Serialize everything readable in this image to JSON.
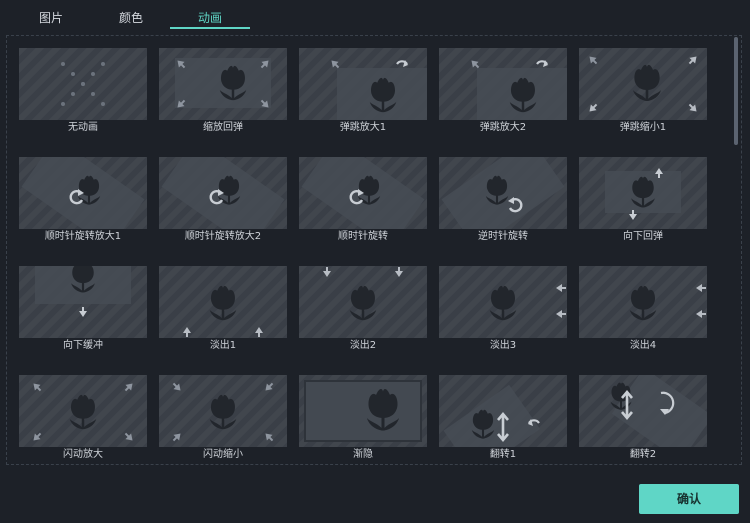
{
  "tabs": [
    {
      "label": "图片",
      "active": false
    },
    {
      "label": "颜色",
      "active": false
    },
    {
      "label": "动画",
      "active": true
    }
  ],
  "colors": {
    "accent": "#5fd6c6",
    "background": "#1d2128",
    "thumb": "#3a3f47"
  },
  "animations": [
    {
      "label": "无动画",
      "icon": "dots-x-icon"
    },
    {
      "label": "缩放回弹",
      "icon": "zoom-rebound-icon"
    },
    {
      "label": "弹跳放大1",
      "icon": "bounce-zoom-in-icon"
    },
    {
      "label": "弹跳放大2",
      "icon": "bounce-zoom-in-icon"
    },
    {
      "label": "弹跳缩小1",
      "icon": "bounce-zoom-out-icon"
    },
    {
      "label": "顺时针旋转放大1",
      "icon": "rotate-cw-icon"
    },
    {
      "label": "顺时针旋转放大2",
      "icon": "rotate-cw-icon"
    },
    {
      "label": "顺时针旋转",
      "icon": "rotate-cw-icon"
    },
    {
      "label": "逆时针旋转",
      "icon": "rotate-ccw-icon"
    },
    {
      "label": "向下回弹",
      "icon": "down-rebound-icon"
    },
    {
      "label": "向下缓冲",
      "icon": "down-buffer-icon"
    },
    {
      "label": "淡出1",
      "icon": "fade-out-up-icon"
    },
    {
      "label": "淡出2",
      "icon": "fade-out-down-icon"
    },
    {
      "label": "淡出3",
      "icon": "fade-out-horizontal-icon"
    },
    {
      "label": "淡出4",
      "icon": "fade-out-horizontal-icon"
    },
    {
      "label": "闪动放大",
      "icon": "flash-zoom-in-icon"
    },
    {
      "label": "闪动缩小",
      "icon": "flash-zoom-out-icon"
    },
    {
      "label": "渐隐",
      "icon": "fade-icon"
    },
    {
      "label": "翻转1",
      "icon": "flip-icon"
    },
    {
      "label": "翻转2",
      "icon": "flip-icon"
    }
  ],
  "confirm_label": "确认"
}
